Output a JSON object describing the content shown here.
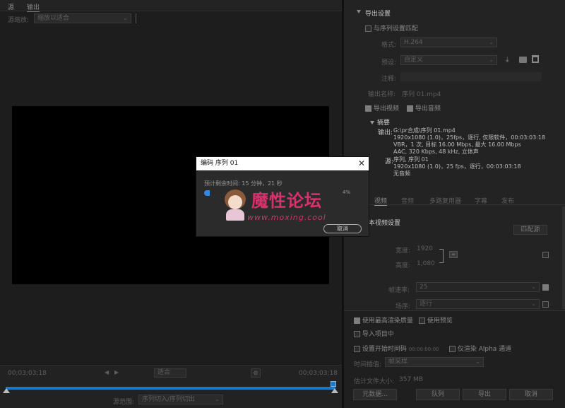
{
  "tabs": {
    "source": "源",
    "output": "输出"
  },
  "left": {
    "source_scaling_label": "源缩放:",
    "source_scaling_value": "缩放以适合",
    "timecode_left": "00;03;03;18",
    "timecode_right": "00;03;03;18",
    "fit_value": "适合",
    "range_label": "源范围:",
    "range_value": "序列切入/序列切出"
  },
  "export_settings": {
    "title": "导出设置",
    "match_sequence": "与序列设置匹配",
    "format_label": "格式:",
    "format_value": "H.264",
    "preset_label": "预设:",
    "preset_value": "自定义",
    "comment_label": "注释:",
    "output_name_label": "输出名称:",
    "output_name_value": "序列 01.mp4",
    "export_video": "导出视频",
    "export_audio": "导出音频",
    "summary_title": "摘要",
    "output_label": "输出:",
    "output_lines": [
      "G:\\pr合成\\序列 01.mp4",
      "1920x1080 (1.0)，25fps，逐行, 仅限软件，00:03:03:18",
      "VBR，1 次, 目标 16.00 Mbps, 最大 16.00 Mbps",
      "AAC, 320 Kbps, 48  kHz, 立体声"
    ],
    "source_label": "源:",
    "source_lines": [
      "序列, 序列 01",
      "1920x1080 (1.0)，25 fps，逐行，00:03:03:18",
      "无音频"
    ]
  },
  "panel_tabs": [
    "视频",
    "音频",
    "多路复用器",
    "字幕",
    "发布"
  ],
  "video_settings": {
    "title": "本视频设置",
    "match_source": "匹配源",
    "width_label": "宽度:",
    "width_value": "1920",
    "height_label": "高度:",
    "height_value": "1,080",
    "fps_label": "帧速率:",
    "fps_value": "25",
    "field_label": "场序:",
    "field_value": "逐行"
  },
  "bottom_options": {
    "max_render": "使用最高渲染质量",
    "use_preview": "使用预览",
    "import_project": "导入项目中",
    "set_start_tc": "设置开始时间码",
    "start_tc_value": "00:00:00:00",
    "render_alpha": "仅渲染 Alpha 通道",
    "time_interp_label": "时间插值:",
    "time_interp_value": "帧采样",
    "est_size_label": "估计文件大小:",
    "est_size_value": "357 MB",
    "metadata_btn": "元数据...",
    "queue_btn": "队列",
    "export_btn": "导出",
    "cancel_btn": "取消"
  },
  "dialog": {
    "title": "编码 序列 01",
    "remaining_label": "预计剩余时间:",
    "remaining_value": "15 分钟，21 秒",
    "progress_text": "4%",
    "progress": 0.04,
    "cancel_btn": "取消"
  },
  "watermark": {
    "title": "魔性论坛",
    "url": "www.moxing.cool"
  }
}
